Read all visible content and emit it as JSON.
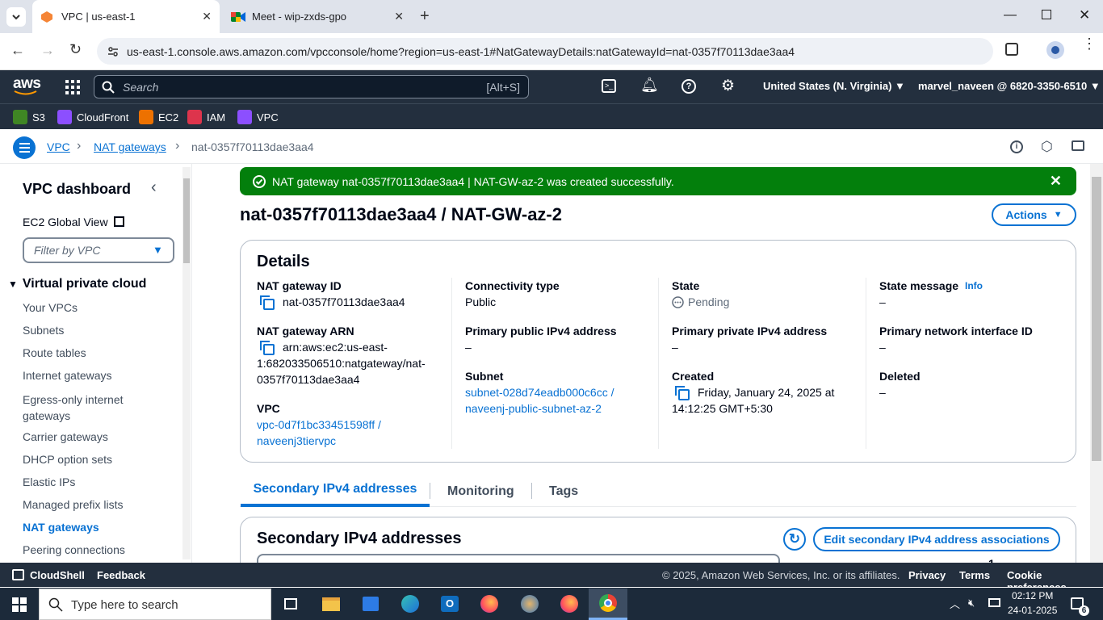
{
  "browser": {
    "tabs": [
      {
        "title": "VPC | us-east-1"
      },
      {
        "title": "Meet - wip-zxds-gpo"
      }
    ],
    "url": "us-east-1.console.aws.amazon.com/vpcconsole/home?region=us-east-1#NatGatewayDetails:natGatewayId=nat-0357f70113dae3aa4"
  },
  "aws_header": {
    "logo": "aws",
    "search_placeholder": "Search",
    "search_shortcut": "[Alt+S]",
    "region": "United States (N. Virginia)",
    "account": "marvel_naveen @ 6820-3350-6510"
  },
  "favorites": [
    {
      "label": "S3",
      "color": "#3f8624"
    },
    {
      "label": "CloudFront",
      "color": "#8c4fff"
    },
    {
      "label": "EC2",
      "color": "#ed7100"
    },
    {
      "label": "IAM",
      "color": "#dd344c"
    },
    {
      "label": "VPC",
      "color": "#8c4fff"
    }
  ],
  "breadcrumb": {
    "items": [
      "VPC",
      "NAT gateways"
    ],
    "current": "nat-0357f70113dae3aa4"
  },
  "sidebar": {
    "title": "VPC dashboard",
    "global_view": "EC2 Global View",
    "filter_placeholder": "Filter by VPC",
    "section": "Virtual private cloud",
    "items": [
      "Your VPCs",
      "Subnets",
      "Route tables",
      "Internet gateways",
      "Egress-only internet gateways",
      "Carrier gateways",
      "DHCP option sets",
      "Elastic IPs",
      "Managed prefix lists",
      "NAT gateways",
      "Peering connections"
    ]
  },
  "flash": {
    "message": "NAT gateway nat-0357f70113dae3aa4 | NAT-GW-az-2 was created successfully."
  },
  "page": {
    "title": "nat-0357f70113dae3aa4 / NAT-GW-az-2",
    "actions_label": "Actions"
  },
  "details": {
    "heading": "Details",
    "nat_id_label": "NAT gateway ID",
    "nat_id": "nat-0357f70113dae3aa4",
    "nat_arn_label": "NAT gateway ARN",
    "nat_arn_l1": "arn:aws:ec2:us-east-",
    "nat_arn_l2": "1:682033506510:natgateway/nat-",
    "nat_arn_l3": "0357f70113dae3aa4",
    "vpc_label": "VPC",
    "vpc_l1": "vpc-0d7f1bc33451598ff /",
    "vpc_l2": "naveenj3tiervpc",
    "conn_type_label": "Connectivity type",
    "conn_type": "Public",
    "pub_ip_label": "Primary public IPv4 address",
    "pub_ip": "–",
    "subnet_label": "Subnet",
    "subnet_l1": "subnet-028d74eadb000c6cc /",
    "subnet_l2": "naveenj-public-subnet-az-2",
    "state_label": "State",
    "state": "Pending",
    "priv_ip_label": "Primary private IPv4 address",
    "priv_ip": "–",
    "created_label": "Created",
    "created_l1": "Friday, January 24, 2025 at",
    "created_l2": "14:12:25 GMT+5:30",
    "state_msg_label": "State message",
    "info": "Info",
    "state_msg": "–",
    "eni_label": "Primary network interface ID",
    "eni": "–",
    "deleted_label": "Deleted",
    "deleted": "–"
  },
  "tabs": [
    "Secondary IPv4 addresses",
    "Monitoring",
    "Tags"
  ],
  "secondary": {
    "heading": "Secondary IPv4 addresses",
    "edit_button": "Edit secondary IPv4 address associations",
    "pagination": "1"
  },
  "footer": {
    "cloudshell": "CloudShell",
    "feedback": "Feedback",
    "copyright": "© 2025, Amazon Web Services, Inc. or its affiliates.",
    "privacy": "Privacy",
    "terms": "Terms",
    "cookies": "Cookie preferences"
  },
  "taskbar": {
    "search_placeholder": "Type here to search",
    "time": "02:12 PM",
    "date": "24-01-2025",
    "notif_count": "6"
  }
}
